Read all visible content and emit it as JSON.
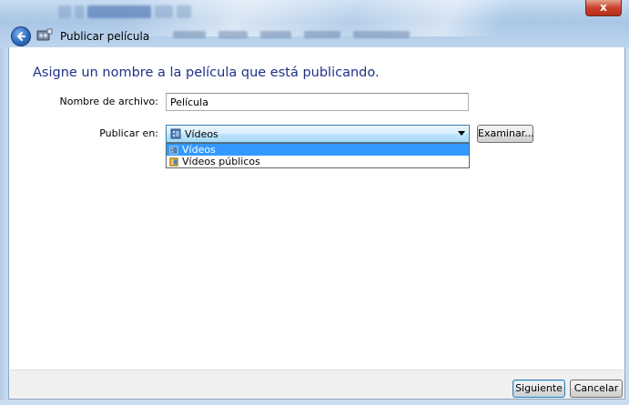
{
  "window": {
    "title": "Publicar película",
    "close_label": "x"
  },
  "wizard": {
    "heading": "Asigne un nombre a la película que está publicando."
  },
  "form": {
    "filename_label": "Nombre de archivo:",
    "filename_value": "Película",
    "publish_label": "Publicar en:",
    "publish_selected": "Vídeos",
    "publish_options": [
      "Vídeos",
      "Vídeos públicos"
    ],
    "browse_label": "Examinar..."
  },
  "footer": {
    "next_label": "Siguiente",
    "cancel_label": "Cancelar"
  },
  "colors": {
    "heading": "#1e3287",
    "selection": "#3399ff"
  },
  "icons": {
    "back": "back-arrow-icon",
    "wizard": "movie-maker-icon",
    "library": "video-library-icon",
    "public_library": "public-videos-library-icon"
  }
}
